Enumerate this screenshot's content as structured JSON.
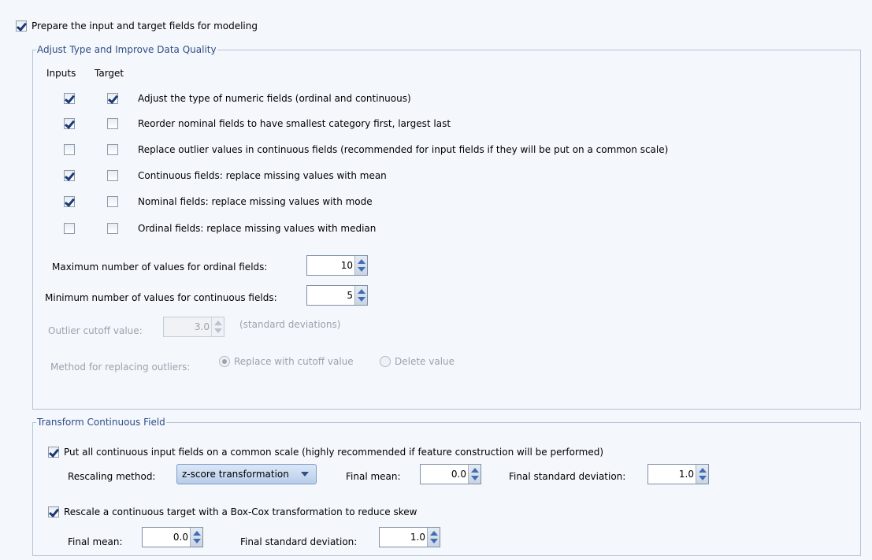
{
  "prepare_checkbox": {
    "label": "Prepare the input and target fields for modeling",
    "checked": true
  },
  "adjust_group": {
    "title": "Adjust Type and Improve Data Quality",
    "col_inputs": "Inputs",
    "col_target": "Target",
    "rows": [
      {
        "label": "Adjust the type of numeric fields (ordinal and continuous)",
        "inputs": true,
        "target": true
      },
      {
        "label": "Reorder nominal fields to have smallest category first, largest last",
        "inputs": true,
        "target": false
      },
      {
        "label": "Replace outlier values in continuous fields (recommended for input fields if they will be put on a common scale)",
        "inputs": false,
        "target": false
      },
      {
        "label": "Continuous fields: replace missing values with mean",
        "inputs": true,
        "target": false
      },
      {
        "label": "Nominal fields: replace missing values with mode",
        "inputs": true,
        "target": false
      },
      {
        "label": "Ordinal fields: replace missing values with median",
        "inputs": false,
        "target": false
      }
    ],
    "max_ordinal": {
      "label": "Maximum number of values for ordinal fields:",
      "value": "10"
    },
    "min_continuous": {
      "label": "Minimum number of values for continuous fields:",
      "value": "5"
    },
    "outlier_cutoff": {
      "label": "Outlier cutoff value:",
      "value": "3.0",
      "unit": "(standard deviations)"
    },
    "outlier_method": {
      "label": "Method for replacing outliers:",
      "options": [
        "Replace with cutoff value",
        "Delete value"
      ],
      "selected": "Replace with cutoff value"
    }
  },
  "transform_group": {
    "title": "Transform Continuous Field",
    "common_scale": {
      "label": "Put all continuous input fields on a common scale (highly recommended if feature construction will be performed)",
      "checked": true
    },
    "rescaling_method_label": "Rescaling method:",
    "rescaling_method_value": "z-score transformation",
    "final_mean_label": "Final mean:",
    "final_mean_value": "0.0",
    "final_sd_label": "Final standard deviation:",
    "final_sd_value": "1.0",
    "boxcox": {
      "label": "Rescale a continuous target with a Box-Cox transformation to reduce skew",
      "checked": true
    },
    "boxcox_mean_label": "Final mean:",
    "boxcox_mean_value": "0.0",
    "boxcox_sd_label": "Final standard deviation:",
    "boxcox_sd_value": "1.0"
  }
}
